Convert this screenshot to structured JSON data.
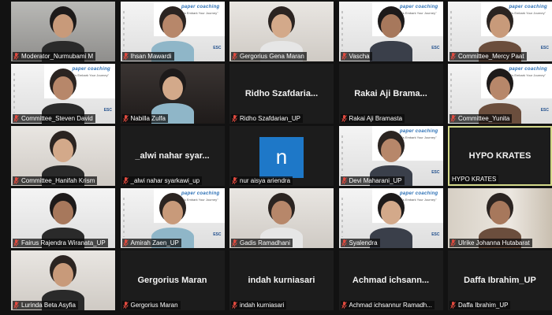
{
  "meeting": {
    "participants": [
      {
        "name": "Moderator_Nurmubami M",
        "display": "",
        "video": true,
        "bg": "room"
      },
      {
        "name": "Ihsan Mawardi",
        "display": "",
        "video": true,
        "bg": "poster-wide"
      },
      {
        "name": "Gergorius Gena Maran",
        "display": "",
        "video": true,
        "bg": "light"
      },
      {
        "name": "Vascha",
        "display": "",
        "video": true,
        "bg": "poster"
      },
      {
        "name": "Committee_Mercy Paat",
        "display": "",
        "video": true,
        "bg": "poster"
      },
      {
        "name": "Committee_Steven David",
        "display": "",
        "video": true,
        "bg": "poster"
      },
      {
        "name": "Nabilla Zulfa",
        "display": "",
        "video": true,
        "bg": "dark"
      },
      {
        "name": "Ridho Szafdarian_UP",
        "display": "Ridho Szafdaria...",
        "video": false
      },
      {
        "name": "Rakai Aji Bramasta",
        "display": "Rakai Aji Brama...",
        "video": false
      },
      {
        "name": "Committee_Yunita",
        "display": "",
        "video": true,
        "bg": "poster"
      },
      {
        "name": "Committee_Hanifah Krism",
        "display": "",
        "video": true,
        "bg": "light"
      },
      {
        "name": "_alwi nahar syarkawi_up",
        "display": "_alwi nahar syar...",
        "video": false
      },
      {
        "name": "nur aisya ariendra",
        "display": "",
        "video": false,
        "avatar_letter": "n"
      },
      {
        "name": "Devi Maharani_UP",
        "display": "",
        "video": true,
        "bg": "poster"
      },
      {
        "name": "HYPO KRATES",
        "display": "HYPO KRATES",
        "video": false,
        "active_speaker": true
      },
      {
        "name": "Fairus Rajendra Wiranata_UP",
        "display": "",
        "video": true,
        "bg": "white"
      },
      {
        "name": "Amirah Zaen_UP",
        "display": "",
        "video": true,
        "bg": "poster"
      },
      {
        "name": "Gadis Ramadhani",
        "display": "",
        "video": true,
        "bg": "light"
      },
      {
        "name": "Syalendra",
        "display": "",
        "video": true,
        "bg": "poster"
      },
      {
        "name": "Ulrike Johanna Hutabarat",
        "display": "",
        "video": true,
        "bg": "bookshelf"
      },
      {
        "name": "Lurinda Beta Asyfia",
        "display": "",
        "video": true,
        "bg": "light"
      },
      {
        "name": "Gergorius Maran",
        "display": "Gergorius Maran",
        "video": false
      },
      {
        "name": "indah kurniasari",
        "display": "indah kurniasari",
        "video": false
      },
      {
        "name": "Achmad ichsannur Ramadh...",
        "display": "Achmad ichsann...",
        "video": false
      },
      {
        "name": "Daffa Ibrahim_UP",
        "display": "Daffa Ibrahim_UP",
        "video": false
      }
    ],
    "poster": {
      "title": "paper coaching",
      "subtitle": "\"Let's Embark Your Journey\"",
      "logo": "ESC"
    },
    "icons": {
      "mic": "muted-mic-icon"
    },
    "colors": {
      "muted": "#e04a3f",
      "active_border": "#d4d98a",
      "avatar": "#1e78c8"
    }
  }
}
